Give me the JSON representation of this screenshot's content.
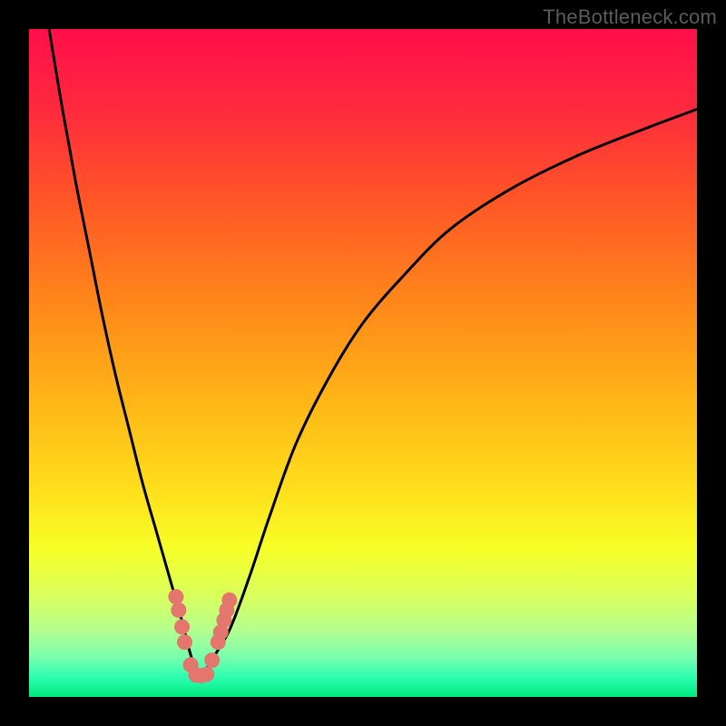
{
  "watermark": "TheBottleneck.com",
  "gradient": {
    "stops": [
      {
        "offset": 0.0,
        "color": "#ff0e4a"
      },
      {
        "offset": 0.12,
        "color": "#ff2a3e"
      },
      {
        "offset": 0.25,
        "color": "#ff5427"
      },
      {
        "offset": 0.4,
        "color": "#ff841a"
      },
      {
        "offset": 0.55,
        "color": "#ffb317"
      },
      {
        "offset": 0.7,
        "color": "#ffe21c"
      },
      {
        "offset": 0.78,
        "color": "#f6ff28"
      },
      {
        "offset": 0.85,
        "color": "#d8ff5e"
      },
      {
        "offset": 0.9,
        "color": "#b4ff8e"
      },
      {
        "offset": 0.94,
        "color": "#7affad"
      },
      {
        "offset": 0.97,
        "color": "#2dffb2"
      },
      {
        "offset": 1.0,
        "color": "#00e97d"
      }
    ]
  },
  "chart_data": {
    "type": "line",
    "title": "",
    "xlabel": "",
    "ylabel": "",
    "xlim": [
      0,
      100
    ],
    "ylim": [
      0,
      100
    ],
    "series": [
      {
        "name": "bottleneck-curve",
        "x": [
          3,
          5,
          7,
          9,
          11,
          13,
          15,
          17,
          19,
          21,
          23,
          24,
          25,
          26,
          27,
          30,
          33,
          36,
          40,
          45,
          50,
          56,
          63,
          72,
          82,
          92,
          100
        ],
        "y": [
          100,
          88,
          77,
          67,
          57,
          48,
          40,
          32,
          25,
          18,
          11,
          7,
          4,
          3,
          5,
          10,
          18,
          27,
          38,
          48,
          56,
          63,
          70,
          76,
          81,
          85,
          88
        ]
      }
    ],
    "markers": {
      "name": "highlight-dots",
      "color": "#e3766d",
      "points": [
        {
          "x": 22.0,
          "y": 15.0
        },
        {
          "x": 22.4,
          "y": 13.0
        },
        {
          "x": 22.9,
          "y": 10.5
        },
        {
          "x": 23.3,
          "y": 8.2
        },
        {
          "x": 24.2,
          "y": 4.8
        },
        {
          "x": 25.0,
          "y": 3.3
        },
        {
          "x": 25.8,
          "y": 3.2
        },
        {
          "x": 26.6,
          "y": 3.4
        },
        {
          "x": 27.4,
          "y": 5.5
        },
        {
          "x": 28.3,
          "y": 8.2
        },
        {
          "x": 28.7,
          "y": 9.7
        },
        {
          "x": 29.2,
          "y": 11.5
        },
        {
          "x": 29.6,
          "y": 13.0
        },
        {
          "x": 30.0,
          "y": 14.5
        }
      ]
    }
  }
}
